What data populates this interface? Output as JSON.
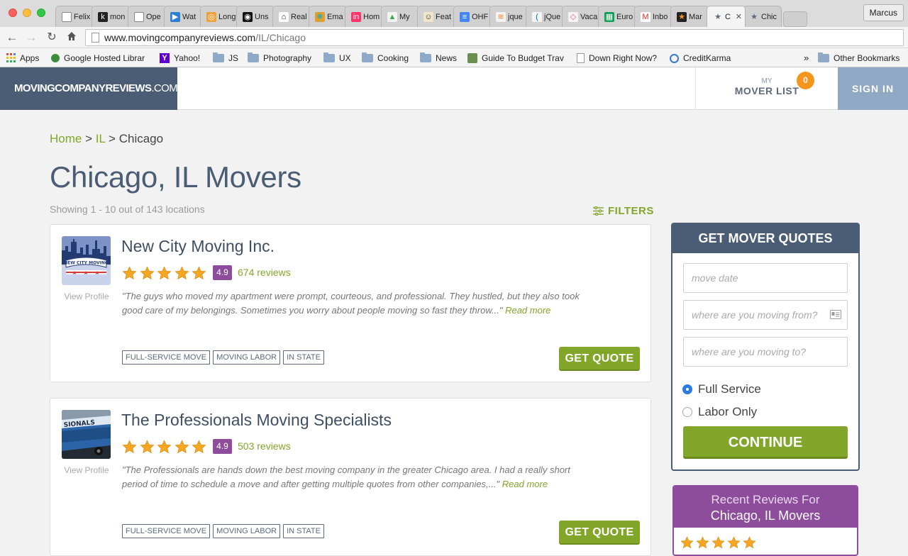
{
  "browser": {
    "tabs": [
      {
        "label": "Felix",
        "icon": "page-icon"
      },
      {
        "label": "mon",
        "icon": "k-icon"
      },
      {
        "label": "Ope",
        "icon": "page-icon"
      },
      {
        "label": "Wat",
        "icon": "play-icon"
      },
      {
        "label": "Long",
        "icon": "circle-icon"
      },
      {
        "label": "Uns",
        "icon": "camera-icon"
      },
      {
        "label": "Real",
        "icon": "house-icon"
      },
      {
        "label": "Ema",
        "icon": "color-wheel-icon"
      },
      {
        "label": "Hom",
        "icon": "invision-icon"
      },
      {
        "label": "My",
        "icon": "drive-icon"
      },
      {
        "label": "Feat",
        "icon": "chimp-icon"
      },
      {
        "label": "OHF",
        "icon": "doc-icon"
      },
      {
        "label": "jque",
        "icon": "stack-icon"
      },
      {
        "label": "jQue",
        "icon": "jquery-icon"
      },
      {
        "label": "Vaca",
        "icon": "airbnb-icon"
      },
      {
        "label": "Euro",
        "icon": "sheets-icon"
      },
      {
        "label": "Inbo",
        "icon": "gmail-icon"
      },
      {
        "label": "Mar",
        "icon": "star-dark-icon"
      },
      {
        "label": "C",
        "icon": "star-icon"
      },
      {
        "label": "Chic",
        "icon": "star-icon"
      }
    ],
    "profile": "Marcus",
    "url_host": "www.movingcompanyreviews.com",
    "url_path": "/IL/Chicago",
    "bookmarks": [
      {
        "label": "Apps"
      },
      {
        "label": "Google Hosted Librar"
      },
      {
        "label": "Yahoo!"
      },
      {
        "label": "JS"
      },
      {
        "label": "Photography"
      },
      {
        "label": "UX"
      },
      {
        "label": "Cooking"
      },
      {
        "label": "News"
      },
      {
        "label": "Guide To Budget Trav"
      },
      {
        "label": "Down Right Now?"
      },
      {
        "label": "CreditKarma"
      },
      {
        "label": "Other Bookmarks"
      }
    ],
    "overflow": "»"
  },
  "site": {
    "logo_main": "MOVINGCOMPANYREVIEWS",
    "logo_com": ".COM",
    "mover_list_small": "MY",
    "mover_list_label": "MOVER LIST",
    "mover_list_count": "0",
    "sign_in": "SIGN IN"
  },
  "breadcrumb": {
    "home": "Home",
    "sep": ">",
    "state": "IL",
    "city": "Chicago"
  },
  "page_title": "Chicago, IL Movers",
  "showing": "Showing 1 - 10 out of 143 locations",
  "filters_label": "FILTERS",
  "listings": [
    {
      "name": "New City Moving Inc.",
      "rating": "4.9",
      "stars": 5,
      "reviews": "674 reviews",
      "quote": "\"The guys who moved my apartment were prompt, courteous, and professional. They hustled, but they also took good care of my belongings. Sometimes you worry about people moving so fast they throw...\"",
      "read_more": "Read more",
      "view_profile": "View Profile",
      "tags": [
        "FULL-SERVICE MOVE",
        "MOVING LABOR",
        "IN STATE"
      ],
      "cta": "GET QUOTE"
    },
    {
      "name": "The Professionals Moving Specialists",
      "rating": "4.9",
      "stars": 5,
      "reviews": "503 reviews",
      "quote": "\"The Professionals are hands down the best moving company in the greater Chicago area. I had a really short period of time to schedule a move and after getting multiple quotes from other companies,...\"",
      "read_more": "Read more",
      "view_profile": "View Profile",
      "tags": [
        "FULL-SERVICE MOVE",
        "MOVING LABOR",
        "IN STATE"
      ],
      "cta": "GET QUOTE"
    }
  ],
  "quote_form": {
    "title": "GET MOVER QUOTES",
    "move_date_placeholder": "move date",
    "from_placeholder": "where are you moving from?",
    "to_placeholder": "where are you moving to?",
    "option_full": "Full Service",
    "option_labor": "Labor Only",
    "selected": "Full Service",
    "continue": "CONTINUE"
  },
  "recent_reviews": {
    "line1": "Recent Reviews For",
    "line2": "Chicago, IL Movers",
    "stars": 5
  },
  "colors": {
    "navy": "#4b5d74",
    "green": "#82a62a",
    "purple": "#8d4d9c",
    "orange": "#f4951c",
    "star": "#f5a623"
  }
}
